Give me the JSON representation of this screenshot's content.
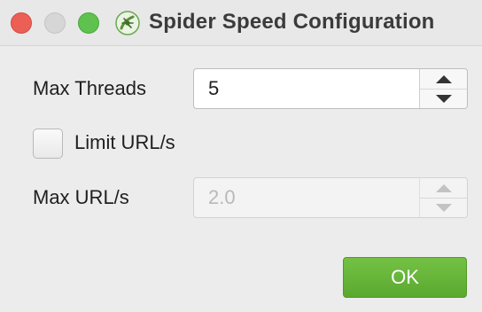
{
  "window": {
    "title": "Spider Speed Configuration",
    "controls": [
      "close",
      "minimize",
      "maximize"
    ]
  },
  "form": {
    "max_threads": {
      "label": "Max Threads",
      "value": "5"
    },
    "limit_urls": {
      "label": "Limit URL/s",
      "checked": false
    },
    "max_urls": {
      "label": "Max URL/s",
      "value": "2.0",
      "disabled": true
    }
  },
  "buttons": {
    "ok_label": "OK"
  },
  "icons": {
    "app": "spider-app-icon",
    "spin_up": "triangle-up-icon",
    "spin_down": "triangle-down-icon"
  },
  "colors": {
    "close": "#ec5f57",
    "minimize": "#d6d6d6",
    "maximize": "#5fc24f",
    "ok_button": "#64b337"
  }
}
